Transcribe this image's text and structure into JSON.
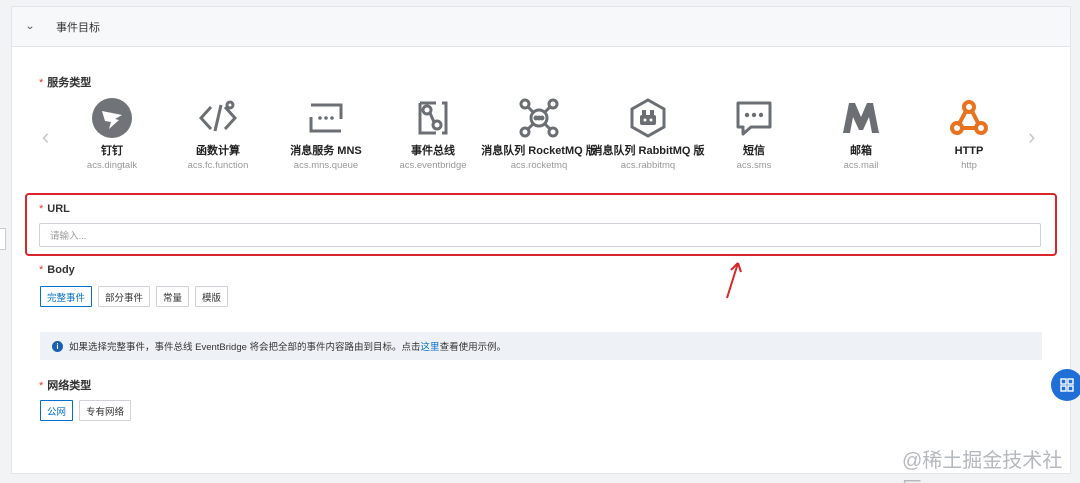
{
  "panel": {
    "title": "事件目标"
  },
  "service_type": {
    "label": "服务类型",
    "items": [
      {
        "name": "钉钉",
        "code": "acs.dingtalk",
        "icon": "dingtalk-icon"
      },
      {
        "name": "函数计算",
        "code": "acs.fc.function",
        "icon": "function-compute-icon"
      },
      {
        "name": "消息服务 MNS",
        "code": "acs.mns.queue",
        "icon": "mns-icon"
      },
      {
        "name": "事件总线",
        "code": "acs.eventbridge",
        "icon": "eventbridge-icon"
      },
      {
        "name": "消息队列 RocketMQ 版",
        "code": "acs.rocketmq",
        "icon": "rocketmq-icon"
      },
      {
        "name": "消息队列 RabbitMQ 版",
        "code": "acs.rabbitmq",
        "icon": "rabbitmq-icon"
      },
      {
        "name": "短信",
        "code": "acs.sms",
        "icon": "sms-icon"
      },
      {
        "name": "邮箱",
        "code": "acs.mail",
        "icon": "mail-icon"
      },
      {
        "name": "HTTP",
        "code": "http",
        "icon": "http-webhook-icon"
      }
    ]
  },
  "url": {
    "label": "URL",
    "placeholder": "请输入..."
  },
  "body": {
    "label": "Body",
    "options": [
      "完整事件",
      "部分事件",
      "常量",
      "模版"
    ],
    "selected": "完整事件"
  },
  "info": {
    "before": "如果选择完整事件，事件总线 EventBridge 将会把全部的事件内容路由到目标。点击",
    "link": "这里",
    "after": "查看使用示例。"
  },
  "network": {
    "label": "网络类型",
    "options": [
      "公网",
      "专有网络"
    ],
    "selected": "公网"
  },
  "watermark": "@稀土掘金技术社区",
  "colors": {
    "accent": "#0070cc",
    "annotation": "#d9262a",
    "http_orange": "#e8731f"
  }
}
